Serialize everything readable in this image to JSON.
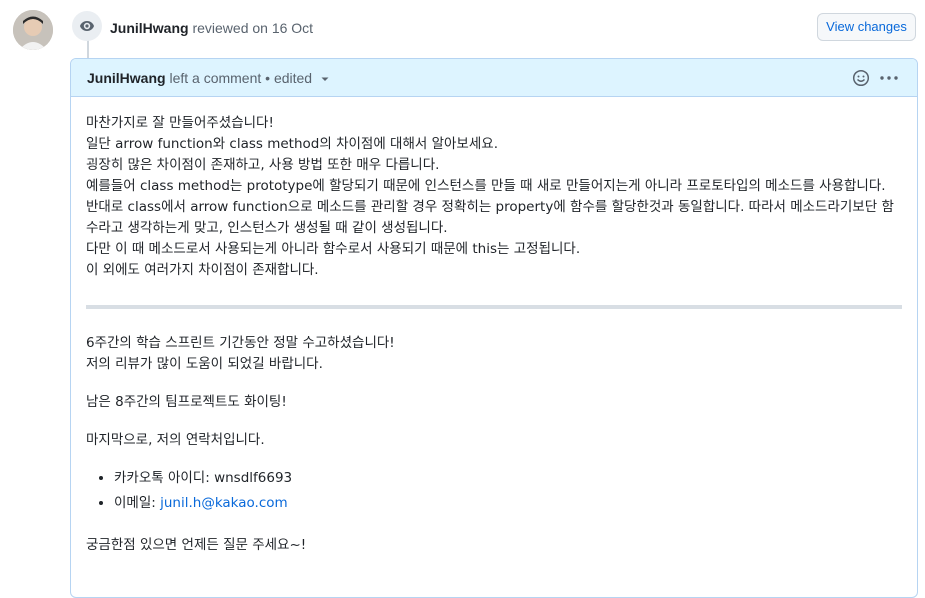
{
  "review": {
    "author": "JunilHwang",
    "action": "reviewed on 16 Oct",
    "view_changes_label": "View changes"
  },
  "comment": {
    "author": "JunilHwang",
    "meta": "left a comment • edited",
    "paragraphs1": [
      "마찬가지로 잘 만들어주셨습니다!",
      "일단 arrow function와 class method의 차이점에 대해서 알아보세요.",
      "굉장히 많은 차이점이 존재하고, 사용 방법 또한 매우 다릅니다.",
      "예를들어 class method는 prototype에 할당되기 때문에 인스턴스를 만들 때 새로 만들어지는게 아니라 프로토타입의 메소드를 사용합니다.",
      "반대로 class에서 arrow function으로 메소드를 관리할 경우 정확히는 property에 함수를 할당한것과 동일합니다. 따라서 메소드라기보단 함수라고 생각하는게 맞고, 인스턴스가 생성될 때 같이 생성됩니다.",
      "다만 이 때 메소드로서 사용되는게 아니라 함수로서 사용되기 때문에 this는 고정됩니다.",
      "이 외에도 여러가지 차이점이 존재합니다."
    ],
    "thanks_line1": "6주간의 학습 스프린트 기간동안 정말 수고하셨습니다!",
    "thanks_line2": "저의 리뷰가 많이 도움이 되었길 바랍니다.",
    "fighting": "남은 8주간의 팀프로젝트도 화이팅!",
    "contact_intro": "마지막으로, 저의 연락처입니다.",
    "kakao": "카카오톡 아이디: wnsdlf6693",
    "email_label": "이메일: ",
    "email": "junil.h@kakao.com",
    "closing": "궁금한점 있으면 언제든 질문 주세요~!"
  }
}
